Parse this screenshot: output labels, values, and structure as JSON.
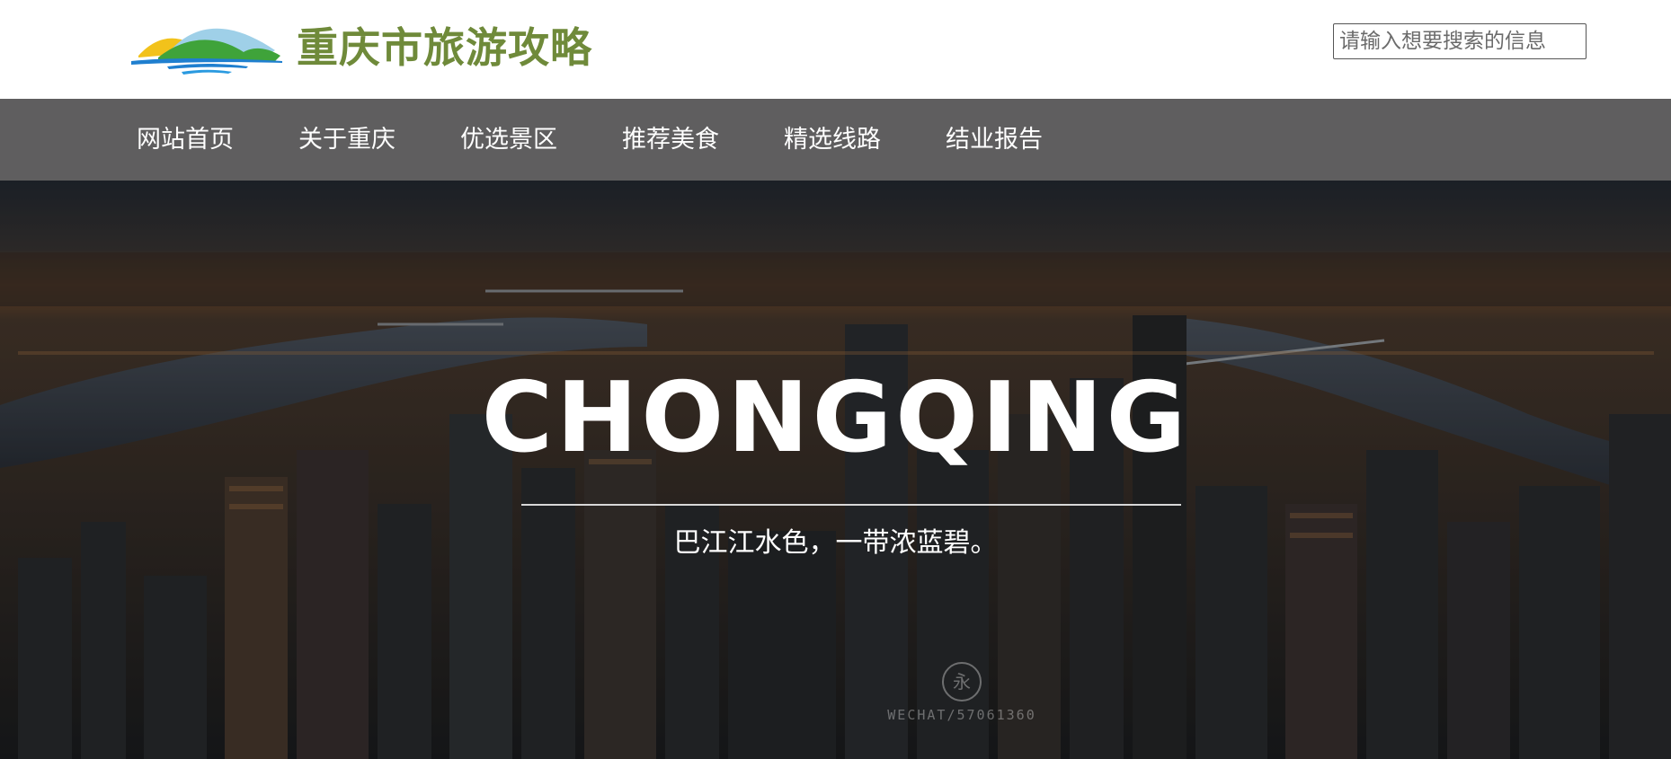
{
  "header": {
    "site_title": "重庆市旅游攻略",
    "logo_icon": "mountains-water-logo",
    "search": {
      "placeholder": "请输入想要搜索的信息",
      "value": ""
    }
  },
  "nav": {
    "items": [
      {
        "label": "网站首页"
      },
      {
        "label": "关于重庆"
      },
      {
        "label": "优选景区"
      },
      {
        "label": "推荐美食"
      },
      {
        "label": "精选线路"
      },
      {
        "label": "结业报告"
      }
    ]
  },
  "hero": {
    "title": "CHONGQING",
    "subtitle": "巴江江水色，一带浓蓝碧。",
    "watermark_text": "WECHAT/57061360"
  },
  "colors": {
    "title_green": "#6f8a3a",
    "nav_bg": "#5f5e5f",
    "nav_text": "#ffffff"
  }
}
